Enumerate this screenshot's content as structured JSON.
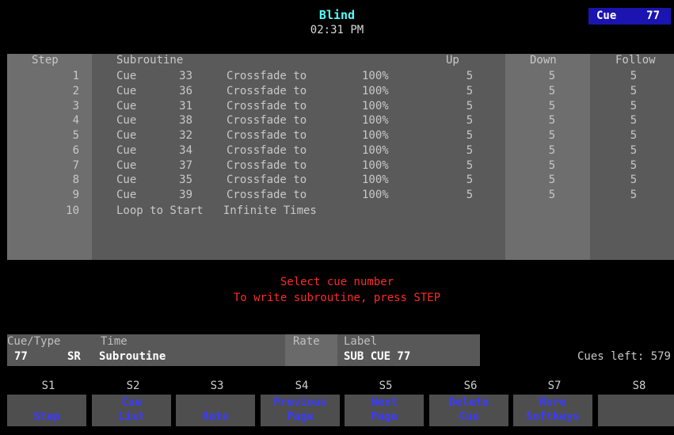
{
  "header": {
    "title": "Blind",
    "time": "02:31 PM",
    "cue_label": "Cue",
    "cue_number": "77"
  },
  "table": {
    "headers": {
      "step": "Step",
      "subroutine": "Subroutine",
      "up": "Up",
      "down": "Down",
      "follow": "Follow"
    },
    "rows": [
      {
        "step": "1",
        "cue_word": "Cue",
        "cue": "33",
        "action": "Crossfade to",
        "level": "100%",
        "up": "5",
        "down": "5",
        "follow": "5"
      },
      {
        "step": "2",
        "cue_word": "Cue",
        "cue": "36",
        "action": "Crossfade to",
        "level": "100%",
        "up": "5",
        "down": "5",
        "follow": "5"
      },
      {
        "step": "3",
        "cue_word": "Cue",
        "cue": "31",
        "action": "Crossfade to",
        "level": "100%",
        "up": "5",
        "down": "5",
        "follow": "5"
      },
      {
        "step": "4",
        "cue_word": "Cue",
        "cue": "38",
        "action": "Crossfade to",
        "level": "100%",
        "up": "5",
        "down": "5",
        "follow": "5"
      },
      {
        "step": "5",
        "cue_word": "Cue",
        "cue": "32",
        "action": "Crossfade to",
        "level": "100%",
        "up": "5",
        "down": "5",
        "follow": "5"
      },
      {
        "step": "6",
        "cue_word": "Cue",
        "cue": "34",
        "action": "Crossfade to",
        "level": "100%",
        "up": "5",
        "down": "5",
        "follow": "5"
      },
      {
        "step": "7",
        "cue_word": "Cue",
        "cue": "37",
        "action": "Crossfade to",
        "level": "100%",
        "up": "5",
        "down": "5",
        "follow": "5"
      },
      {
        "step": "8",
        "cue_word": "Cue",
        "cue": "35",
        "action": "Crossfade to",
        "level": "100%",
        "up": "5",
        "down": "5",
        "follow": "5"
      },
      {
        "step": "9",
        "cue_word": "Cue",
        "cue": "39",
        "action": "Crossfade to",
        "level": "100%",
        "up": "5",
        "down": "5",
        "follow": "5"
      }
    ],
    "loop_row": {
      "step": "10",
      "text": "Loop to Start   Infinite Times"
    }
  },
  "messages": {
    "line1": "Select cue number",
    "line2": "To write subroutine, press STEP"
  },
  "info": {
    "cue_type_label": "Cue/Type",
    "cue_value": "77",
    "type_value": "SR",
    "time_label": "Time",
    "time_value": "Subroutine",
    "rate_label": "Rate",
    "label_label": "Label",
    "label_value": "SUB CUE 77",
    "cues_left": "Cues left: 579"
  },
  "softkeys": [
    {
      "id": "S1",
      "line1": "",
      "line2": "Step"
    },
    {
      "id": "S2",
      "line1": "Cue",
      "line2": "List"
    },
    {
      "id": "S3",
      "line1": "",
      "line2": "Rate"
    },
    {
      "id": "S4",
      "line1": "Previous",
      "line2": "Page"
    },
    {
      "id": "S5",
      "line1": "Next",
      "line2": "Page"
    },
    {
      "id": "S6",
      "line1": "Delete",
      "line2": "Cue"
    },
    {
      "id": "S7",
      "line1": "More",
      "line2": "Softkeys"
    },
    {
      "id": "S8",
      "line1": "",
      "line2": ""
    }
  ],
  "colors": {
    "title": "#55ffff",
    "cue_badge_bg": "#1b14b0",
    "message": "#ff2a2a",
    "softkey_text": "#3b3bff"
  }
}
